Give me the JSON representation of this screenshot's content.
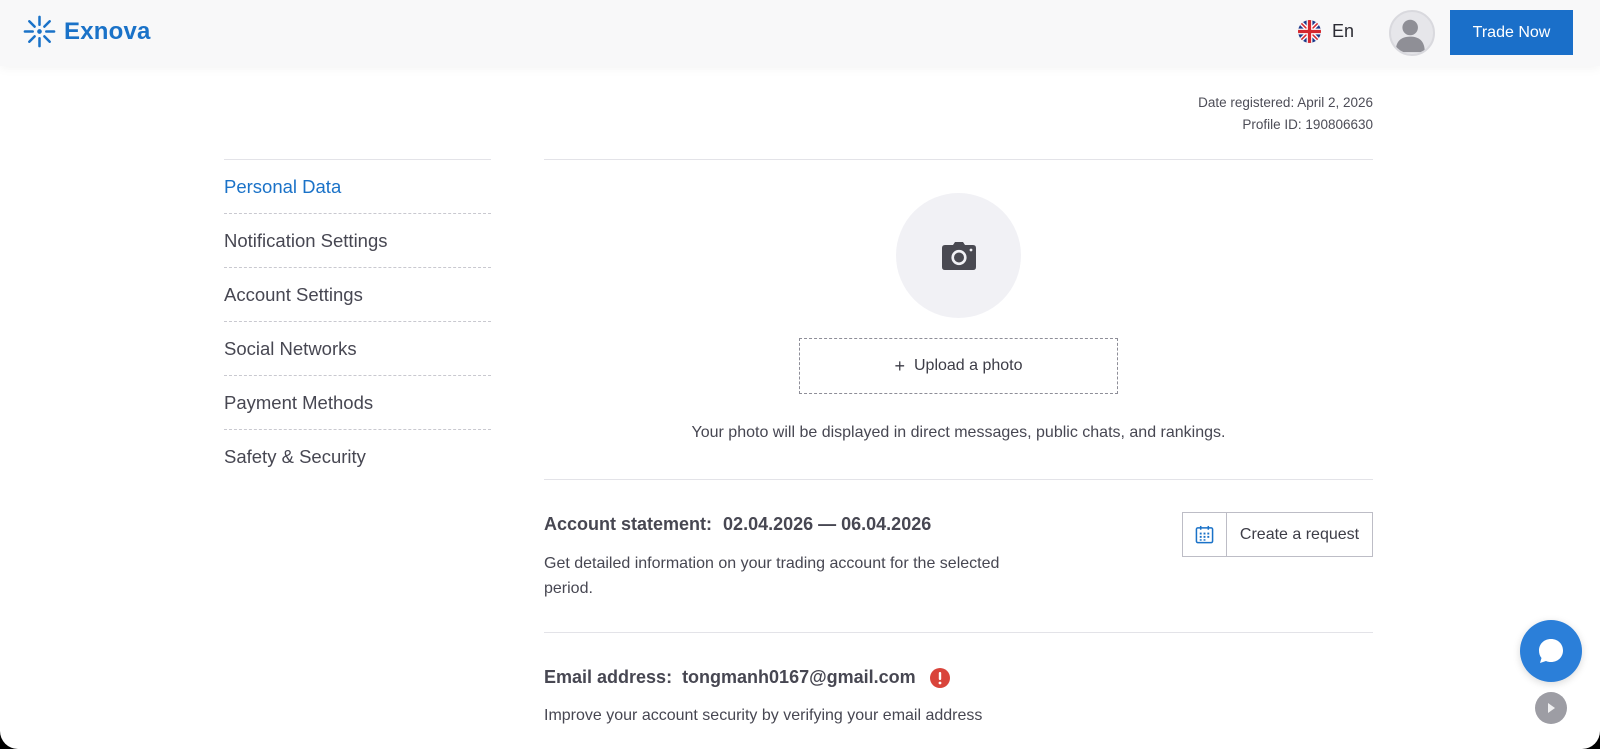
{
  "header": {
    "brand": "Exnova",
    "language": "En",
    "trade_button": "Trade Now"
  },
  "profile_info": {
    "date_registered": "Date registered: April 2, 2026",
    "profile_id": "Profile ID: 190806630"
  },
  "sidebar": {
    "items": [
      {
        "label": "Personal Data",
        "active": true
      },
      {
        "label": "Notification Settings",
        "active": false
      },
      {
        "label": "Account Settings",
        "active": false
      },
      {
        "label": "Social Networks",
        "active": false
      },
      {
        "label": "Payment Methods",
        "active": false
      },
      {
        "label": "Safety & Security",
        "active": false
      }
    ]
  },
  "photo": {
    "upload_label": "Upload a photo",
    "note": "Your photo will be displayed in direct messages, public chats, and rankings."
  },
  "statement": {
    "title": "Account statement:",
    "dates": "02.04.2026 — 06.04.2026",
    "description": "Get detailed information on your trading account for the selected period.",
    "button": "Create a request"
  },
  "email": {
    "title": "Email address:",
    "value": "tongmanh0167@gmail.com",
    "description": "Improve your account security by verifying your email address"
  },
  "colors": {
    "brand": "#1a72c8",
    "button": "#1a6fc9",
    "warning": "#d9443b",
    "chat": "#2b7fd9"
  },
  "icons": [
    "exnova-logo-icon",
    "uk-flag-icon",
    "user-avatar-icon",
    "camera-icon",
    "plus-icon",
    "calendar-icon",
    "warning-icon",
    "chat-icon",
    "play-icon"
  ]
}
